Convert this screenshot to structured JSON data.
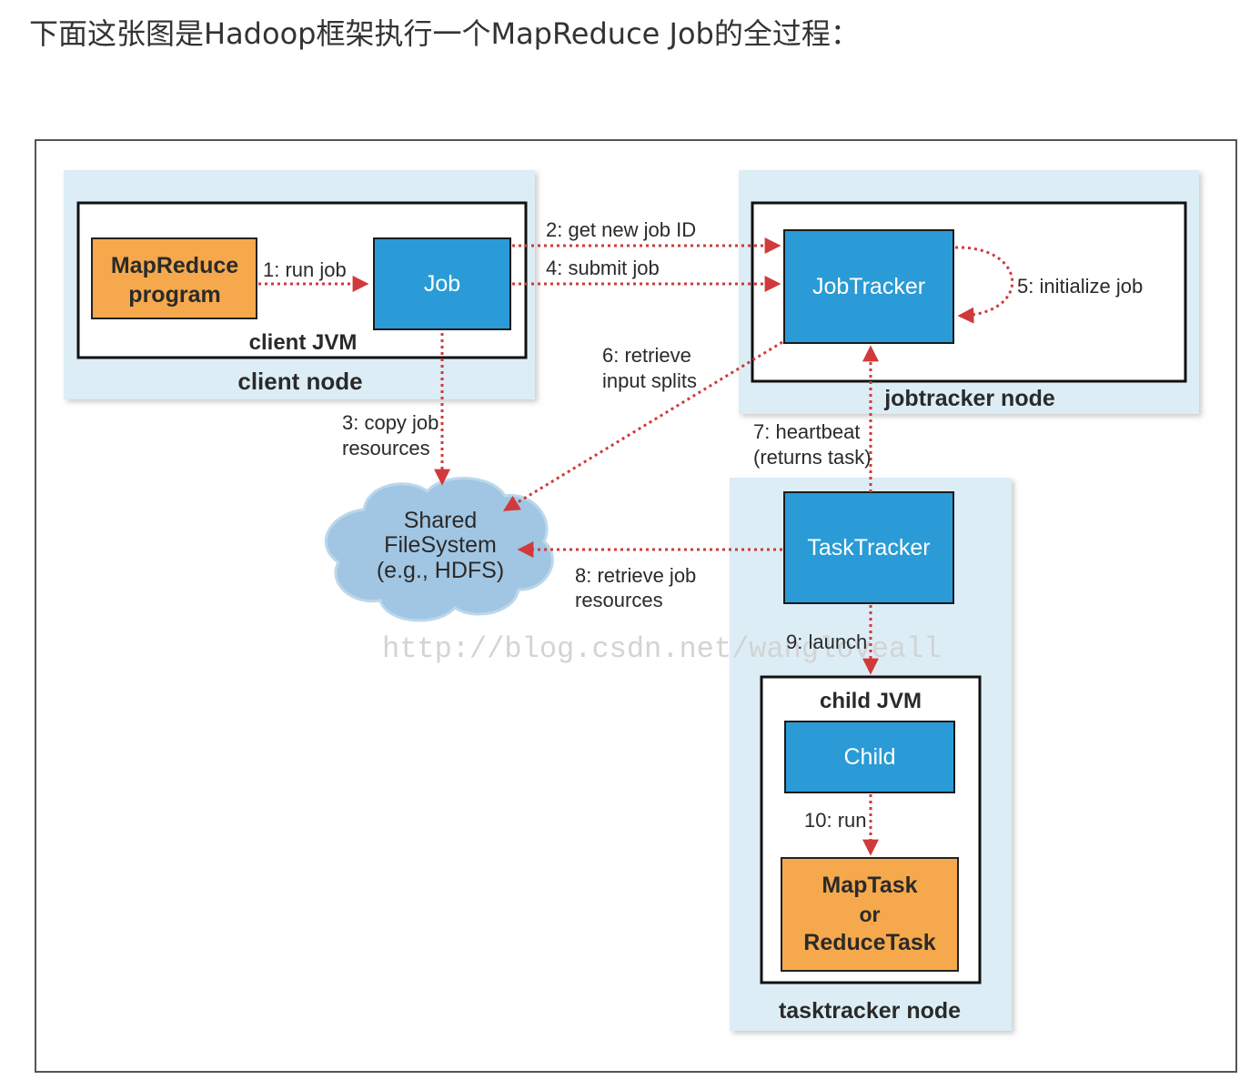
{
  "intro": "下面这张图是Hadoop框架执行一个MapReduce Job的全过程：",
  "colors": {
    "node_background": "#dcedf6",
    "component_blue": "#2a9bd6",
    "program_orange": "#f6a94c",
    "arrow_red": "#d03a3a",
    "cloud": "#9dc3e2"
  },
  "diagram": {
    "nodes": {
      "client_node": "client node",
      "client_jvm": "client JVM",
      "jobtracker_node": "jobtracker node",
      "tasktracker_node": "tasktracker node",
      "child_jvm": "child JVM"
    },
    "boxes": {
      "mapreduce_program_line1": "MapReduce",
      "mapreduce_program_line2": "program",
      "job": "Job",
      "jobtracker": "JobTracker",
      "tasktracker": "TaskTracker",
      "child": "Child",
      "task_line1": "MapTask",
      "task_line2": "or",
      "task_line3": "ReduceTask"
    },
    "shared_fs": {
      "line1": "Shared",
      "line2": "FileSystem",
      "line3": "(e.g., HDFS)"
    },
    "steps": {
      "s1": "1: run job",
      "s2": "2: get new job ID",
      "s3_line1": "3: copy job",
      "s3_line2": "resources",
      "s4": "4: submit job",
      "s5": "5: initialize job",
      "s6_line1": "6: retrieve",
      "s6_line2": "input splits",
      "s7_line1": "7: heartbeat",
      "s7_line2": "(returns task)",
      "s8_line1": "8: retrieve job",
      "s8_line2": "resources",
      "s9": "9: launch",
      "s10": "10: run"
    },
    "watermark": "http://blog.csdn.net/wangloveall"
  }
}
